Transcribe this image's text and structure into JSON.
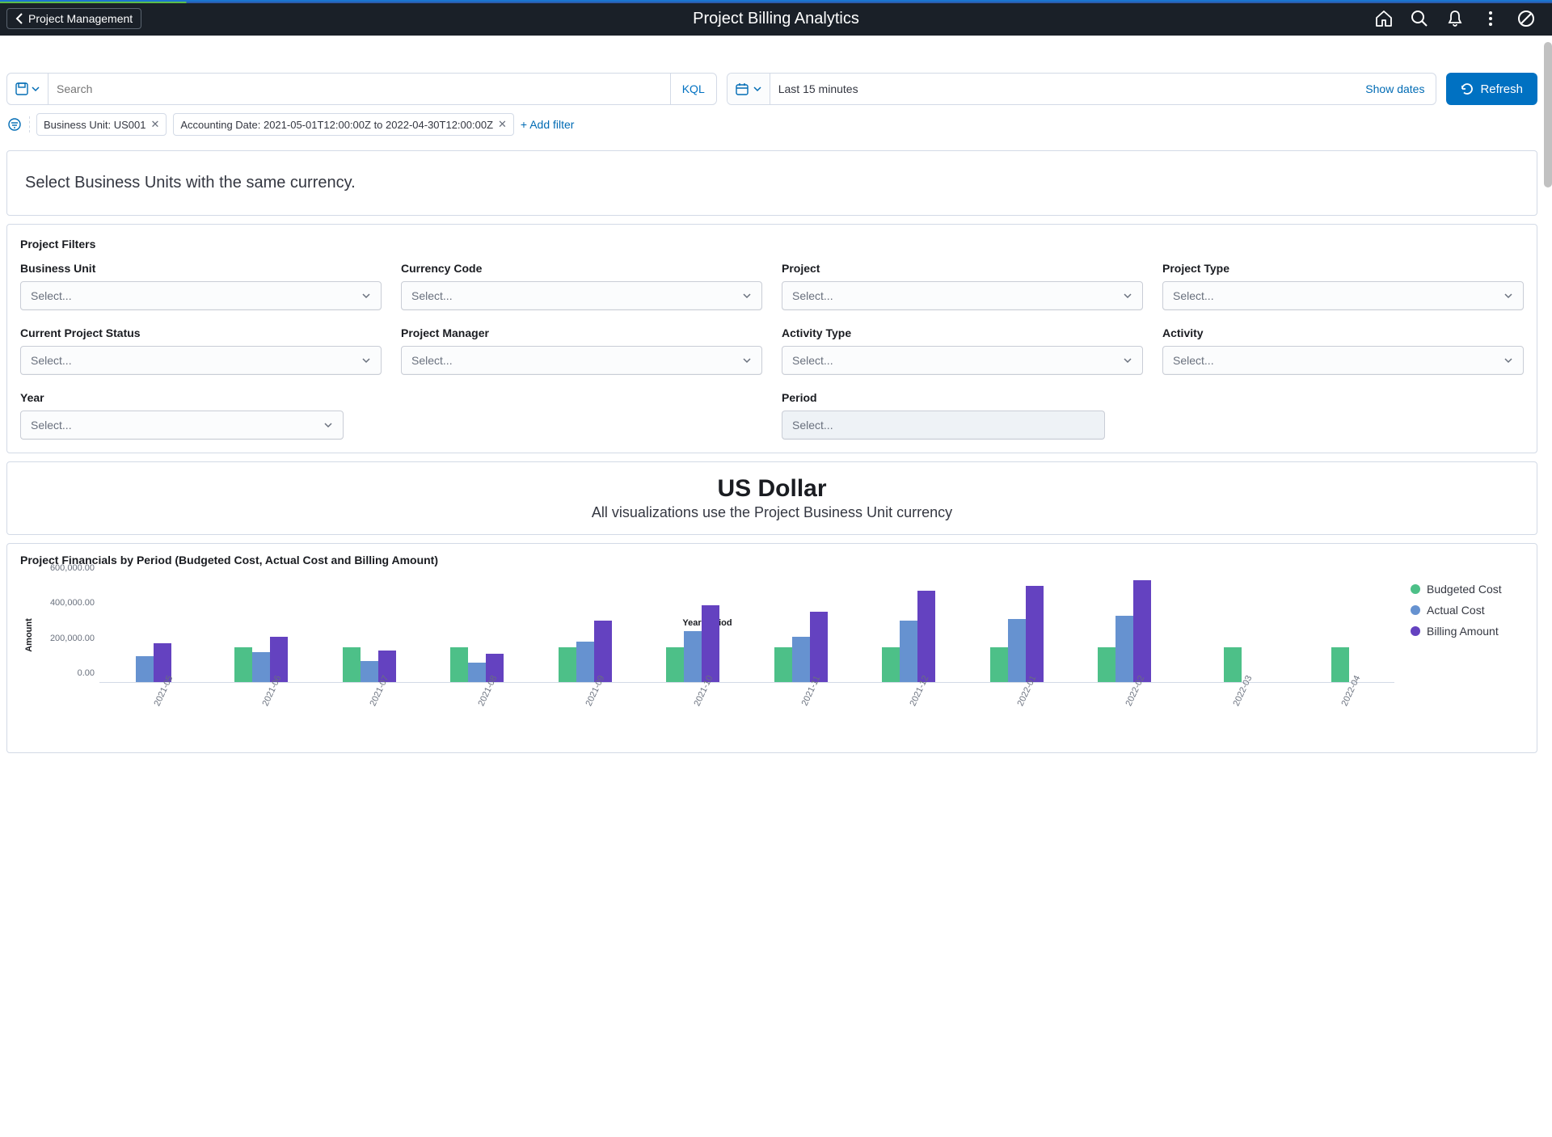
{
  "header": {
    "back_label": "Project Management",
    "title": "Project Billing Analytics"
  },
  "query": {
    "search_placeholder": "Search",
    "kql": "KQL",
    "time_range": "Last 15 minutes",
    "show_dates": "Show dates",
    "refresh": "Refresh"
  },
  "active_filters": {
    "f1": "Business Unit: US001",
    "f2": "Accounting Date: 2021-05-01T12:00:00Z to 2022-04-30T12:00:00Z",
    "add": "+ Add filter"
  },
  "info_banner": "Select Business Units with the same currency.",
  "project_filters": {
    "title": "Project Filters",
    "business_unit": "Business Unit",
    "currency_code": "Currency Code",
    "project": "Project",
    "project_type": "Project Type",
    "current_status": "Current Project Status",
    "project_manager": "Project Manager",
    "activity_type": "Activity Type",
    "activity": "Activity",
    "year": "Year",
    "period": "Period",
    "select_placeholder": "Select..."
  },
  "currency_panel": {
    "title": "US Dollar",
    "subtitle": "All visualizations use the Project Business Unit currency"
  },
  "chart_data": {
    "type": "bar",
    "title": "Project Financials by Period (Budgeted Cost, Actual Cost and Billing Amount)",
    "xlabel": "Year-Period",
    "ylabel": "Amount",
    "ylim": [
      0,
      600000
    ],
    "y_ticks": [
      "0.00",
      "200,000.00",
      "400,000.00",
      "600,000.00"
    ],
    "categories": [
      "2021-05",
      "2021-06",
      "2021-07",
      "2021-08",
      "2021-09",
      "2021-10",
      "2021-11",
      "2021-12",
      "2022-01",
      "2022-02",
      "2022-03",
      "2022-04"
    ],
    "series": [
      {
        "name": "Budgeted Cost",
        "color": "#4dc088",
        "values": [
          0,
          200000,
          200000,
          200000,
          200000,
          200000,
          200000,
          200000,
          200000,
          200000,
          200000,
          200000
        ]
      },
      {
        "name": "Actual Cost",
        "color": "#6692d0",
        "values": [
          150000,
          170000,
          120000,
          110000,
          230000,
          290000,
          260000,
          350000,
          360000,
          380000,
          0,
          0
        ]
      },
      {
        "name": "Billing Amount",
        "color": "#6442c0",
        "values": [
          220000,
          260000,
          180000,
          160000,
          350000,
          440000,
          400000,
          520000,
          550000,
          580000,
          0,
          0
        ]
      }
    ]
  }
}
